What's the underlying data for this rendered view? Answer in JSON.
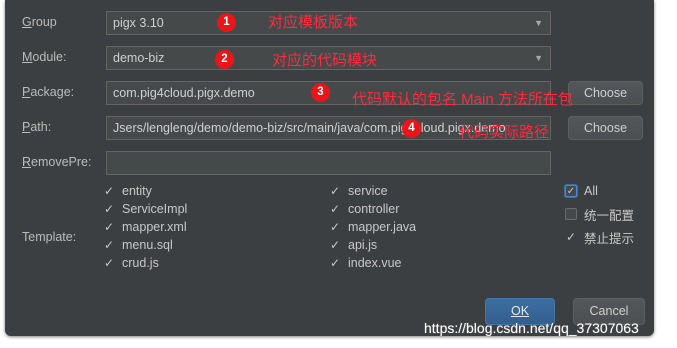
{
  "form": {
    "group": {
      "label_mn": "G",
      "label_rest": "roup",
      "value": "pigx 3.10"
    },
    "module": {
      "label_mn": "M",
      "label_rest": "odule:",
      "value": "demo-biz"
    },
    "package": {
      "label_mn": "P",
      "label_rest": "ackage:",
      "value": "com.pig4cloud.pigx.demo",
      "button": "Choose"
    },
    "path": {
      "label_mn": "P",
      "label_rest": "ath:",
      "value": "Jsers/lengleng/demo/demo-biz/src/main/java/com.pig4cloud.pigx.demo",
      "button": "Choose"
    },
    "removepre": {
      "label_mn": "R",
      "label_rest": "emovePre:",
      "value": ""
    }
  },
  "template": {
    "label": "Template:",
    "col1": [
      "entity",
      "ServiceImpl",
      "mapper.xml",
      "menu.sql",
      "crud.js"
    ],
    "col2": [
      "service",
      "controller",
      "mapper.java",
      "api.js",
      "index.vue"
    ],
    "options": [
      {
        "label": "All",
        "checked": true
      },
      {
        "label": "统一配置",
        "checked": false
      },
      {
        "label": "禁止提示",
        "checked": true
      }
    ]
  },
  "buttons": {
    "ok": "OK",
    "cancel": "Cancel"
  },
  "annotations": [
    {
      "num": "1",
      "text": "对应模板版本"
    },
    {
      "num": "2",
      "text": "对应的代码模块"
    },
    {
      "num": "3",
      "text": "代码默认的包名 Main 方法所在包"
    },
    {
      "num": "4",
      "text": "代码实际路径"
    }
  ],
  "watermark": "https://blog.csdn.net/qq_37307063",
  "colors": {
    "annotation_red": "#e8161a",
    "dialog_bg": "#3c3f41",
    "ok_blue": "#365f8a"
  }
}
